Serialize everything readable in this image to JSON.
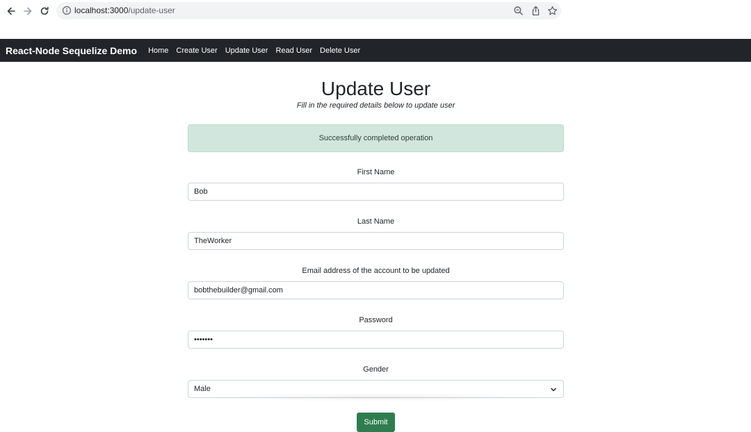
{
  "browser": {
    "url_host": "localhost:3000",
    "url_path": "/update-user",
    "icons": [
      "back-icon",
      "forward-icon",
      "reload-icon",
      "info-icon",
      "zoom-icon",
      "share-icon",
      "star-icon"
    ]
  },
  "navbar": {
    "brand": "React-Node Sequelize Demo",
    "links": [
      "Home",
      "Create User",
      "Update User",
      "Read User",
      "Delete User"
    ],
    "background": "#212529"
  },
  "page": {
    "title": "Update User",
    "subtitle": "Fill in the required details below to update user"
  },
  "alert": {
    "message": "Successfully completed operation",
    "background": "#d1e7dd"
  },
  "form": {
    "first_name": {
      "label": "First Name",
      "value": "Bob"
    },
    "last_name": {
      "label": "Last Name",
      "value": "TheWorker"
    },
    "email": {
      "label": "Email address of the account to be updated",
      "value": "bobthebuilder@gmail.com"
    },
    "password": {
      "label": "Password",
      "value": "•••••••"
    },
    "gender": {
      "label": "Gender",
      "value": "Male"
    },
    "submit_label": "Submit",
    "submit_color": "#2e7d4f"
  }
}
